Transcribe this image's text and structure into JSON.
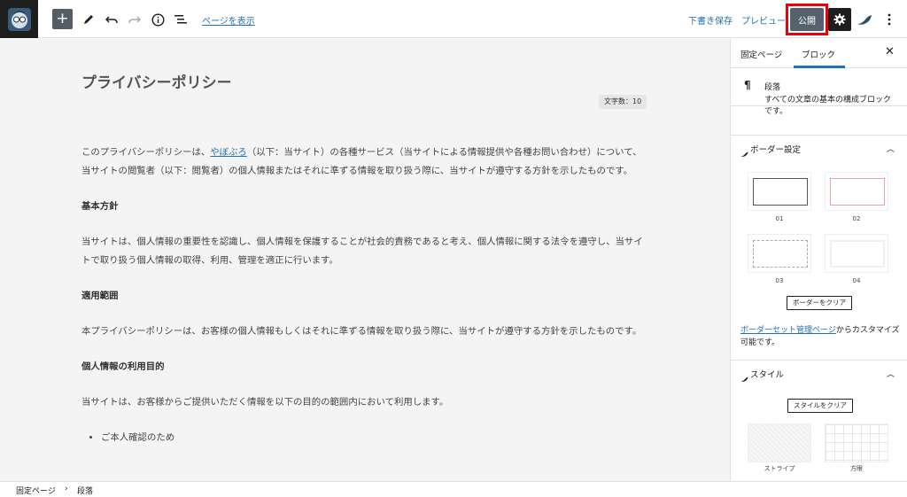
{
  "toolbar": {
    "view_page_link": "ページを表示",
    "save_draft": "下書き保存",
    "preview": "プレビュー",
    "publish": "公開"
  },
  "editor": {
    "title": "プライバシーポリシー",
    "word_count": "文字数：10",
    "intro_pre": "このプライバシーポリシーは、",
    "intro_link": "やぼぶろ",
    "intro_post": "（以下：当サイト）の各種サービス（当サイトによる情報提供や各種お問い合わせ）について、当サイトの閲覧者（以下：閲覧者）の個人情報またはそれに準ずる情報を取り扱う際に、当サイトが遵守する方針を示したものです。",
    "h_basic": "基本方針",
    "p_basic": "当サイトは、個人情報の重要性を認識し、個人情報を保護することが社会的責務であると考え、個人情報に関する法令を遵守し、当サイトで取り扱う個人情報の取得、利用、管理を適正に行います。",
    "h_scope": "適用範囲",
    "p_scope": "本プライバシーポリシーは、お客様の個人情報もしくはそれに準ずる情報を取り扱う際に、当サイトが遵守する方針を示したものです。",
    "h_purpose": "個人情報の利用目的",
    "p_purpose": "当サイトは、お客様からご提供いただく情報を以下の目的の範囲内において利用します。",
    "list_item_1": "ご本人確認のため"
  },
  "sidebar": {
    "tab_page": "固定ページ",
    "tab_block": "ブロック",
    "block_name": "段落",
    "block_desc": "すべての文章の基本の構成ブロックです。",
    "border_panel_title": "ボーダー設定",
    "border_labels": [
      "01",
      "02",
      "03",
      "04"
    ],
    "clear_border": "ボーダーをクリア",
    "note_link": "ボーダーセット管理ページ",
    "note_text": "からカスタマイズ可能です。",
    "style_panel_title": "スタイル",
    "clear_style": "スタイルをクリア",
    "style_labels": [
      "ストライプ",
      "方眼"
    ]
  },
  "footer": {
    "crumb_1": "固定ページ",
    "crumb_sep": "›",
    "crumb_2": "段落"
  },
  "colors": {
    "accent_link": "#2271b1",
    "publish_bg": "#55626d",
    "highlight_red": "#e8000b"
  }
}
